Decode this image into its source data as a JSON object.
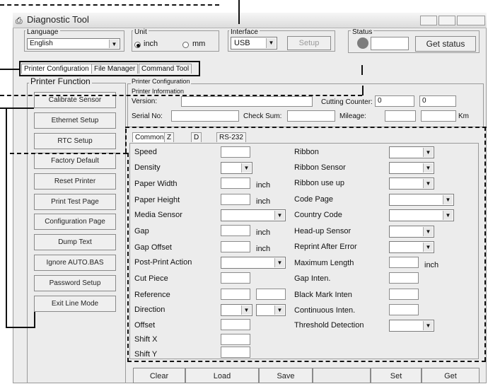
{
  "window": {
    "title": "Diagnostic Tool"
  },
  "language": {
    "label": "Language",
    "value": "English"
  },
  "unit": {
    "label": "Unit",
    "options": [
      "inch",
      "mm"
    ],
    "selected": "inch"
  },
  "interface": {
    "label": "Interface",
    "value": "USB",
    "setup": "Setup"
  },
  "status": {
    "label": "Status",
    "button": "Get status"
  },
  "tabs": [
    "Printer Configuration",
    "File Manager",
    "Command Tool"
  ],
  "function": {
    "label": "Printer Function",
    "buttons": [
      "Calibrate Sensor",
      "Ethernet Setup",
      "RTC Setup",
      "Factory Default",
      "Reset Printer",
      "Print Test Page",
      "Configuration Page",
      "Dump Text",
      "Ignore AUTO.BAS",
      "Password Setup",
      "Exit Line Mode"
    ]
  },
  "config": {
    "title": "Printer Configuration",
    "info_title": "Printer Information",
    "version": "Version:",
    "cutting_counter": "Cutting Counter:",
    "cutting_value1": "0",
    "cutting_value2": "0",
    "serial": "Serial No:",
    "checksum": "Check Sum:",
    "mileage": "Mileage:",
    "km": "Km"
  },
  "subtabs": [
    "Common",
    "Z",
    "D",
    "RS-232"
  ],
  "left_fields": [
    "Speed",
    "Density",
    "Paper Width",
    "Paper Height",
    "Media Sensor",
    "Gap",
    "Gap Offset",
    "Post-Print Action",
    "Cut Piece",
    "Reference",
    "Direction",
    "Offset",
    "Shift X",
    "Shift Y"
  ],
  "right_fields": [
    "Ribbon",
    "Ribbon Sensor",
    "Ribbon use up",
    "Code Page",
    "Country Code",
    "Head-up Sensor",
    "Reprint After Error",
    "Maximum Length",
    "Gap Inten.",
    "Black Mark Inten",
    "Continuous Inten.",
    "Threshold Detection"
  ],
  "unit_labels": {
    "inch": "inch"
  },
  "bottom_buttons": [
    "Clear",
    "Load",
    "Save",
    "Set",
    "Get"
  ]
}
